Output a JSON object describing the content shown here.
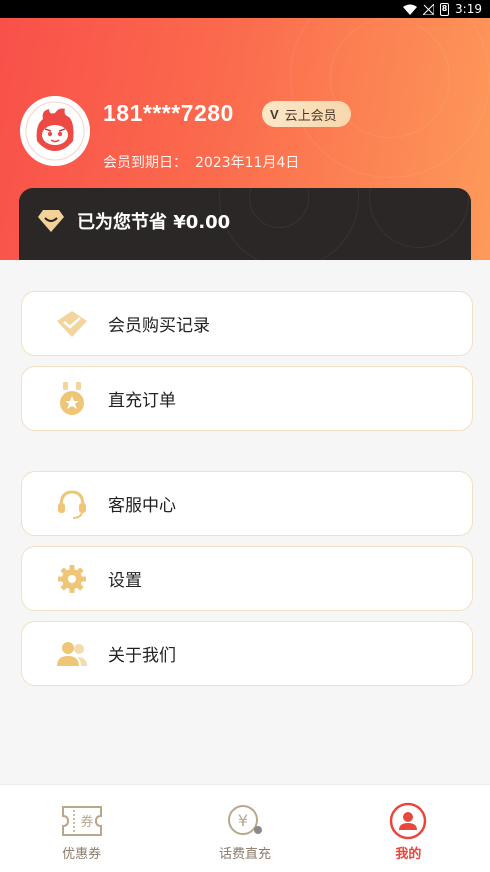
{
  "status_bar": {
    "time": "3:19",
    "battery_label": "8"
  },
  "profile": {
    "phone": "181****7280",
    "vip_badge_prefix": "V",
    "vip_badge_label": "云上会员",
    "expiry_label": "会员到期日：",
    "expiry_date": "2023年11月4日"
  },
  "savings": {
    "text": "已为您节省 ¥0.00"
  },
  "menu": {
    "purchase_records": "会员购买记录",
    "direct_orders": "直充订单",
    "customer_service": "客服中心",
    "settings": "设置",
    "about_us": "关于我们"
  },
  "bottom_nav": {
    "items": [
      {
        "label": "优惠券",
        "icon": "coupon-icon"
      },
      {
        "label": "话费直充",
        "icon": "phone-bill-icon"
      },
      {
        "label": "我的",
        "icon": "profile-icon"
      }
    ],
    "active_index": 2,
    "coupon_glyph": "券",
    "yuan_glyph": "¥"
  },
  "colors": {
    "header_start": "#f9504a",
    "header_end": "#fd9a5a",
    "gold": "#e9b96a",
    "active": "#e8473c"
  }
}
